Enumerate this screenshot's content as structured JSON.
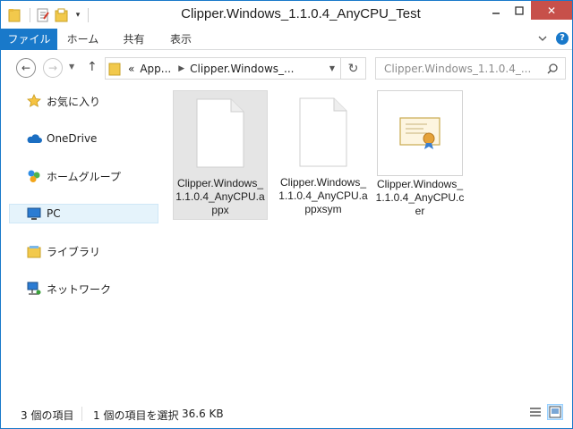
{
  "window": {
    "title": "Clipper.Windows_1.1.0.4_AnyCPU_Test"
  },
  "titlebar": {
    "quick_access": [
      "folder-icon",
      "properties-icon",
      "new-folder-icon",
      "customize-dropdown-icon"
    ],
    "minimize": "minimize-icon",
    "maximize": "maximize-icon",
    "close_label": "✕"
  },
  "ribbon": {
    "tabs": [
      {
        "label": "ファイル"
      },
      {
        "label": "ホーム"
      },
      {
        "label": "共有"
      },
      {
        "label": "表示"
      }
    ],
    "help": "?"
  },
  "address": {
    "overflow": "«",
    "crumbs": [
      "App...",
      "Clipper.Windows_..."
    ],
    "search_placeholder": "Clipper.Windows_1.1.0.4_..."
  },
  "nav": {
    "items": [
      {
        "label": "お気に入り",
        "icon": "star-icon"
      },
      {
        "label": "OneDrive",
        "icon": "cloud-icon"
      },
      {
        "label": "ホームグループ",
        "icon": "homegroup-icon"
      },
      {
        "label": "PC",
        "icon": "computer-icon",
        "selected": true
      },
      {
        "label": "ライブラリ",
        "icon": "library-icon"
      },
      {
        "label": "ネットワーク",
        "icon": "network-icon"
      }
    ]
  },
  "files": [
    {
      "name": "Clipper.Windows_1.1.0.4_AnyCPU.appx",
      "icon": "blank-file-icon",
      "selected": true
    },
    {
      "name": "Clipper.Windows_1.1.0.4_AnyCPU.appxsym",
      "icon": "blank-file-icon",
      "selected": false
    },
    {
      "name": "Clipper.Windows_1.1.0.4_AnyCPU.cer",
      "icon": "certificate-icon",
      "selected": false
    }
  ],
  "status": {
    "item_count": "3 個の項目",
    "selection": "1 個の項目を選択",
    "size": "36.6 KB"
  },
  "colors": {
    "accent": "#1979ca",
    "close": "#c7504a",
    "selection": "#e5f3fb"
  }
}
